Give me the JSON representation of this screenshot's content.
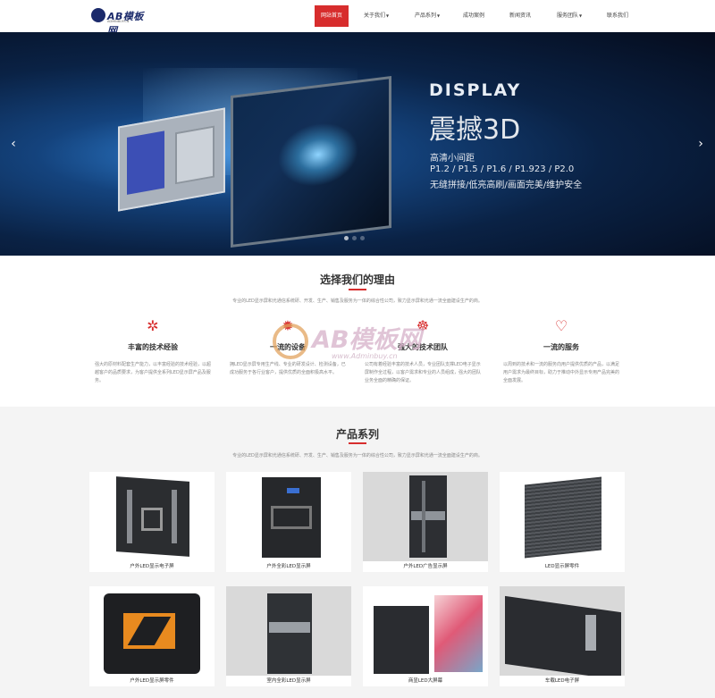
{
  "header": {
    "logo_text": "AB模板网",
    "logo_sub": "ADMINBUY.CN",
    "nav": [
      {
        "label": "网站首页",
        "active": true,
        "caret": false
      },
      {
        "label": "关于我们",
        "active": false,
        "caret": true
      },
      {
        "label": "产品系列",
        "active": false,
        "caret": true
      },
      {
        "label": "成功案例",
        "active": false,
        "caret": false
      },
      {
        "label": "新闻资讯",
        "active": false,
        "caret": false
      },
      {
        "label": "服务团队",
        "active": false,
        "caret": true
      },
      {
        "label": "联系我们",
        "active": false,
        "caret": false
      }
    ]
  },
  "banner": {
    "display": "DISPLAY",
    "title": "震撼3D",
    "line1": "高清小间距",
    "line2": "P1.2 / P1.5 / P1.6 / P1.923 / P2.0",
    "line3": "无缝拼接/低亮高刷/画面完美/维护安全",
    "arrow_left": "‹",
    "arrow_right": "›"
  },
  "why": {
    "title": "选择我们的理由",
    "subtitle": "专业的LED显示屏和光通信系统研、开发、生产、销售及服务为一体的综合性公司，致力显示屏和光通一流全面建设生产的商。",
    "features": [
      {
        "icon": "gears-icon",
        "glyph": "✲",
        "title": "丰富的技术经验",
        "text": "强大的原材料配套生产能力，以丰富经验的技术经验，以超越客户的品质要求，为客户提供全系列LED显示屏产品及服务。"
      },
      {
        "icon": "support-icon",
        "glyph": "✹",
        "title": "一流的设备",
        "text": "拥LED显示屏专用生产线、专业的研发设计、检测设备，已成功服务于各行业客户，提供优质的全面积极高水平。"
      },
      {
        "icon": "team-icon",
        "glyph": "☸",
        "title": "强大的技术团队",
        "text": "公司有着经验丰富的技术人员，专业团队支撑LED电子显示屏制作全过程，以客户需求和专业的人员组成，强大的团队业务全面的精确的保证。"
      },
      {
        "icon": "heart-icon",
        "glyph": "♡",
        "title": "一流的服务",
        "text": "以周到的技术和一流的服务向用户提供优质的产品，以满足用户需求为最终目标，助力于推动中外显示专用产品完美的全面发展。"
      }
    ]
  },
  "watermark": {
    "text": "AB模板网",
    "url": "www.Adminbuy.cn"
  },
  "products": {
    "title": "产品系列",
    "subtitle": "专业的LED显示屏和光通信系统研、开发、生产、销售及服务为一体的综合性公司，致力显示屏和光通一流全面建设生产的商。",
    "items": [
      {
        "label": "户外LED显示电子屏"
      },
      {
        "label": "户外全彩LED显示屏"
      },
      {
        "label": "户外LED广告显示屏"
      },
      {
        "label": "LED显示屏零件"
      },
      {
        "label": "户外LED显示屏零件"
      },
      {
        "label": "室内全彩LED显示屏"
      },
      {
        "label": "商显LED大屏幕"
      },
      {
        "label": "车载LED电子屏"
      }
    ]
  },
  "colors": {
    "accent": "#d72d2d",
    "brand": "#1b2a6b"
  }
}
